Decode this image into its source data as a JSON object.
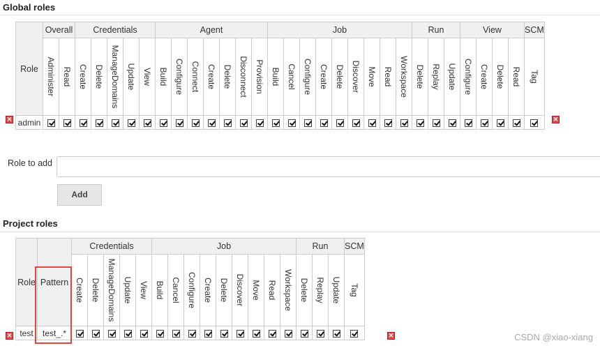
{
  "global_section": {
    "title": "Global roles",
    "role_header": "Role",
    "groups": [
      {
        "label": "Overall",
        "span": 2
      },
      {
        "label": "Credentials",
        "span": 5
      },
      {
        "label": "Agent",
        "span": 7
      },
      {
        "label": "Job",
        "span": 9
      },
      {
        "label": "Run",
        "span": 3
      },
      {
        "label": "View",
        "span": 4
      },
      {
        "label": "SCM",
        "span": 1
      }
    ],
    "permissions": [
      "Administer",
      "Read",
      "Create",
      "Delete",
      "ManageDomains",
      "Update",
      "View",
      "Build",
      "Configure",
      "Connect",
      "Create",
      "Delete",
      "Disconnect",
      "Provision",
      "Build",
      "Cancel",
      "Configure",
      "Create",
      "Delete",
      "Discover",
      "Move",
      "Read",
      "Workspace",
      "Delete",
      "Replay",
      "Update",
      "Configure",
      "Create",
      "Delete",
      "Read",
      "Tag"
    ],
    "rows": [
      {
        "name": "admin",
        "checks": [
          true,
          true,
          true,
          true,
          true,
          true,
          true,
          true,
          true,
          true,
          true,
          true,
          true,
          true,
          true,
          true,
          true,
          true,
          true,
          true,
          true,
          true,
          true,
          true,
          true,
          true,
          true,
          true,
          true,
          true,
          true
        ]
      }
    ]
  },
  "add_role": {
    "label": "Role to add",
    "value": "",
    "button": "Add"
  },
  "project_section": {
    "title": "Project roles",
    "role_header": "Role",
    "pattern_header": "Pattern",
    "groups": [
      {
        "label": "Credentials",
        "span": 5
      },
      {
        "label": "Job",
        "span": 9
      },
      {
        "label": "Run",
        "span": 3
      },
      {
        "label": "SCM",
        "span": 1
      }
    ],
    "permissions": [
      "Create",
      "Delete",
      "ManageDomains",
      "Update",
      "View",
      "Build",
      "Cancel",
      "Configure",
      "Create",
      "Delete",
      "Discover",
      "Move",
      "Read",
      "Workspace",
      "Delete",
      "Replay",
      "Update",
      "Tag"
    ],
    "rows": [
      {
        "name": "test",
        "pattern": "test_.*",
        "checks": [
          true,
          true,
          true,
          true,
          true,
          true,
          true,
          true,
          true,
          true,
          true,
          true,
          true,
          true,
          true,
          true,
          true,
          true
        ]
      }
    ]
  },
  "watermark": "CSDN @xiao-xiang",
  "colors": {
    "highlight": "#e2463c",
    "header_bg": "#f0f0f0",
    "delete_icon": "#e04b4b"
  },
  "icons": {
    "delete": "delete-x-icon",
    "checkbox": "checked-checkbox-icon"
  }
}
